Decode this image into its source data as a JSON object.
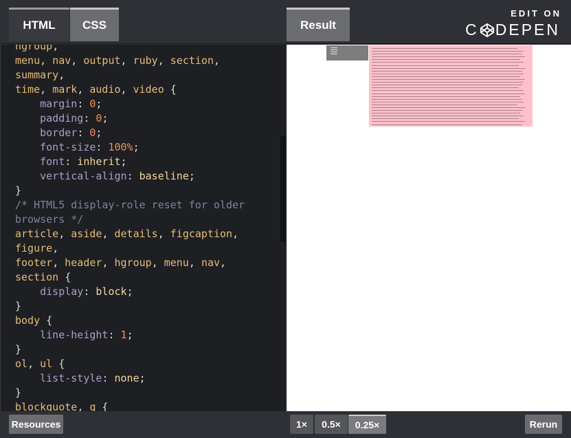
{
  "header": {
    "tabs": [
      {
        "label": "HTML"
      },
      {
        "label": "CSS"
      }
    ],
    "result_tab": "Result",
    "edit_on": "EDIT ON",
    "brand_left": "C",
    "brand_right": "DEPEN"
  },
  "code_lines": [
    {
      "c": [
        {
          "t": "hgroup",
          "k": "sel"
        },
        {
          "t": ",",
          "k": "punc"
        }
      ]
    },
    {
      "c": [
        {
          "t": "menu",
          "k": "sel"
        },
        {
          "t": ", ",
          "k": "punc"
        },
        {
          "t": "nav",
          "k": "sel"
        },
        {
          "t": ", ",
          "k": "punc"
        },
        {
          "t": "output",
          "k": "sel"
        },
        {
          "t": ", ",
          "k": "punc"
        },
        {
          "t": "ruby",
          "k": "sel"
        },
        {
          "t": ", ",
          "k": "punc"
        },
        {
          "t": "section",
          "k": "sel"
        },
        {
          "t": ",",
          "k": "punc"
        }
      ]
    },
    {
      "c": [
        {
          "t": "summary",
          "k": "sel"
        },
        {
          "t": ",",
          "k": "punc"
        }
      ]
    },
    {
      "c": [
        {
          "t": "time",
          "k": "sel"
        },
        {
          "t": ", ",
          "k": "punc"
        },
        {
          "t": "mark",
          "k": "sel"
        },
        {
          "t": ", ",
          "k": "punc"
        },
        {
          "t": "audio",
          "k": "sel"
        },
        {
          "t": ", ",
          "k": "punc"
        },
        {
          "t": "video",
          "k": "sel"
        },
        {
          "t": " {",
          "k": "punc"
        }
      ]
    },
    {
      "c": [
        {
          "t": "    ",
          "k": "punc"
        },
        {
          "t": "margin",
          "k": "prop"
        },
        {
          "t": ": ",
          "k": "punc"
        },
        {
          "t": "0",
          "k": "num"
        },
        {
          "t": ";",
          "k": "punc"
        }
      ]
    },
    {
      "c": [
        {
          "t": "    ",
          "k": "punc"
        },
        {
          "t": "padding",
          "k": "prop"
        },
        {
          "t": ": ",
          "k": "punc"
        },
        {
          "t": "0",
          "k": "num"
        },
        {
          "t": ";",
          "k": "punc"
        }
      ]
    },
    {
      "c": [
        {
          "t": "    ",
          "k": "punc"
        },
        {
          "t": "border",
          "k": "prop"
        },
        {
          "t": ": ",
          "k": "punc"
        },
        {
          "t": "0",
          "k": "num"
        },
        {
          "t": ";",
          "k": "punc"
        }
      ]
    },
    {
      "c": [
        {
          "t": "    ",
          "k": "punc"
        },
        {
          "t": "font-size",
          "k": "prop"
        },
        {
          "t": ": ",
          "k": "punc"
        },
        {
          "t": "100%",
          "k": "num"
        },
        {
          "t": ";",
          "k": "punc"
        }
      ]
    },
    {
      "c": [
        {
          "t": "    ",
          "k": "punc"
        },
        {
          "t": "font",
          "k": "prop"
        },
        {
          "t": ": ",
          "k": "punc"
        },
        {
          "t": "inherit",
          "k": "kw"
        },
        {
          "t": ";",
          "k": "punc"
        }
      ]
    },
    {
      "c": [
        {
          "t": "    ",
          "k": "punc"
        },
        {
          "t": "vertical-align",
          "k": "prop"
        },
        {
          "t": ": ",
          "k": "punc"
        },
        {
          "t": "baseline",
          "k": "kw"
        },
        {
          "t": ";",
          "k": "punc"
        }
      ]
    },
    {
      "c": [
        {
          "t": "}",
          "k": "punc"
        }
      ]
    },
    {
      "c": [
        {
          "t": "/* HTML5 display-role reset for older",
          "k": "cm"
        }
      ]
    },
    {
      "c": [
        {
          "t": "browsers */",
          "k": "cm"
        }
      ]
    },
    {
      "c": [
        {
          "t": "article",
          "k": "sel"
        },
        {
          "t": ", ",
          "k": "punc"
        },
        {
          "t": "aside",
          "k": "sel"
        },
        {
          "t": ", ",
          "k": "punc"
        },
        {
          "t": "details",
          "k": "sel"
        },
        {
          "t": ", ",
          "k": "punc"
        },
        {
          "t": "figcaption",
          "k": "sel"
        },
        {
          "t": ",",
          "k": "punc"
        }
      ]
    },
    {
      "c": [
        {
          "t": "figure",
          "k": "sel"
        },
        {
          "t": ",",
          "k": "punc"
        }
      ]
    },
    {
      "c": [
        {
          "t": "footer",
          "k": "sel"
        },
        {
          "t": ", ",
          "k": "punc"
        },
        {
          "t": "header",
          "k": "sel"
        },
        {
          "t": ", ",
          "k": "punc"
        },
        {
          "t": "hgroup",
          "k": "sel"
        },
        {
          "t": ", ",
          "k": "punc"
        },
        {
          "t": "menu",
          "k": "sel"
        },
        {
          "t": ", ",
          "k": "punc"
        },
        {
          "t": "nav",
          "k": "sel"
        },
        {
          "t": ",",
          "k": "punc"
        }
      ]
    },
    {
      "c": [
        {
          "t": "section",
          "k": "sel"
        },
        {
          "t": " {",
          "k": "punc"
        }
      ]
    },
    {
      "c": [
        {
          "t": "    ",
          "k": "punc"
        },
        {
          "t": "display",
          "k": "prop"
        },
        {
          "t": ": ",
          "k": "punc"
        },
        {
          "t": "block",
          "k": "kw"
        },
        {
          "t": ";",
          "k": "punc"
        }
      ]
    },
    {
      "c": [
        {
          "t": "}",
          "k": "punc"
        }
      ]
    },
    {
      "c": [
        {
          "t": "body",
          "k": "sel"
        },
        {
          "t": " {",
          "k": "punc"
        }
      ]
    },
    {
      "c": [
        {
          "t": "    ",
          "k": "punc"
        },
        {
          "t": "line-height",
          "k": "prop"
        },
        {
          "t": ": ",
          "k": "punc"
        },
        {
          "t": "1",
          "k": "num"
        },
        {
          "t": ";",
          "k": "punc"
        }
      ]
    },
    {
      "c": [
        {
          "t": "}",
          "k": "punc"
        }
      ]
    },
    {
      "c": [
        {
          "t": "ol",
          "k": "sel"
        },
        {
          "t": ", ",
          "k": "punc"
        },
        {
          "t": "ul",
          "k": "sel"
        },
        {
          "t": " {",
          "k": "punc"
        }
      ]
    },
    {
      "c": [
        {
          "t": "    ",
          "k": "punc"
        },
        {
          "t": "list-style",
          "k": "prop"
        },
        {
          "t": ": ",
          "k": "punc"
        },
        {
          "t": "none",
          "k": "kw"
        },
        {
          "t": ";",
          "k": "punc"
        }
      ]
    },
    {
      "c": [
        {
          "t": "}",
          "k": "punc"
        }
      ]
    },
    {
      "c": [
        {
          "t": "blockquote",
          "k": "sel"
        },
        {
          "t": ", ",
          "k": "punc"
        },
        {
          "t": "q",
          "k": "sel"
        },
        {
          "t": " {",
          "k": "punc"
        }
      ]
    }
  ],
  "footer": {
    "resources_label": "Resources",
    "zoom_options": [
      "1×",
      "0.5×",
      "0.25×"
    ],
    "zoom_selected": "0.25×",
    "rerun_label": "Rerun"
  },
  "colors": {
    "selector": "#e3bd78",
    "property": "#a99fc9",
    "number": "#ef8e5a",
    "keyword": "#f5d59d",
    "comment": "#7f829a",
    "result_block": "#ffc0cb"
  }
}
